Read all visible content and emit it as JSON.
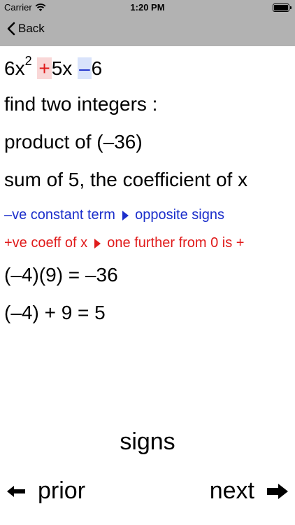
{
  "status": {
    "carrier": "Carrier",
    "time": "1:20 PM"
  },
  "nav": {
    "back_label": "Back"
  },
  "expression": {
    "t1": "6x",
    "exp": "2",
    "op1": "+",
    "t2": "5x",
    "op2": "–",
    "t3": "6"
  },
  "steps": {
    "find": "find two integers :",
    "product": "product of (–36)",
    "sum": "sum of 5, the coefficient of x",
    "rule1_a": "–ve constant term",
    "rule1_b": "opposite signs",
    "rule2_a": "+ve coeff of x",
    "rule2_b": "one further from 0 is +",
    "eq1": "(–4)(9) = –36",
    "eq2": "(–4) + 9 = 5"
  },
  "footer": {
    "title": "signs",
    "prior": "prior",
    "next": "next"
  },
  "colors": {
    "blue": "#1c2fcb",
    "red": "#e01b1b",
    "navbar": "#b2b2b2"
  }
}
